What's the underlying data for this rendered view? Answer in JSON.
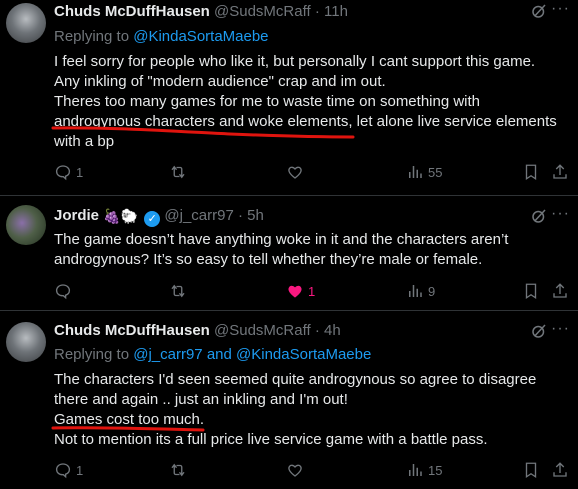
{
  "colors": {
    "background": "#000000",
    "text": "#e7e9ea",
    "muted": "#71767b",
    "link": "#1d9bf0",
    "like_active": "#f91880",
    "underline": "#e0140e"
  },
  "tweets": [
    {
      "name": "Chuds McDuffHausen",
      "handle": "@SudsMcRaff",
      "time": "· 11h",
      "replying_prefix": "Replying to",
      "replying_to": "@KindaSortaMaebe",
      "lines": [
        "I feel sorry for people who like it, but personally I cant support this game.",
        "Any inkling of \"modern audience\" crap and im out.",
        "Theres too many games for me to waste time on something with",
        "androgynous characters and woke elements, let alone live service elements",
        "with a bp"
      ],
      "replies": "1",
      "reposts": "",
      "likes": "",
      "views": "55"
    },
    {
      "name": "Jordie",
      "emojis": [
        "🍇",
        "🐑"
      ],
      "handle": "@j_carr97",
      "time": "· 5h",
      "lines": [
        "The game doesn’t have anything woke in it and the characters aren’t",
        "androgynous? It’s so easy to tell whether they’re male or female."
      ],
      "replies": "",
      "reposts": "",
      "likes": "1",
      "views": "9"
    },
    {
      "name": "Chuds McDuffHausen",
      "handle": "@SudsMcRaff",
      "time": "· 4h",
      "replying_prefix": "Replying to",
      "replying_to_1": "@j_carr97",
      "replying_and": "and",
      "replying_to_2": "@KindaSortaMaebe",
      "lines": [
        "The characters I'd seen seemed quite androgynous so agree to disagree",
        "there and again .. just an inkling and I'm out!",
        "Games cost too much.",
        "Not to mention its a full price live service game with a battle pass."
      ],
      "replies": "1",
      "reposts": "",
      "likes": "",
      "views": "15"
    }
  ],
  "icons": {
    "more": "more-icon",
    "grok": "grok-icon",
    "reply": "reply-icon",
    "repost": "repost-icon",
    "like": "like-icon",
    "views": "views-icon",
    "bookmark": "bookmark-icon",
    "share": "share-icon",
    "verified": "verified-badge-icon"
  },
  "glyphs": {
    "more": "···",
    "verified_check": "✓"
  }
}
